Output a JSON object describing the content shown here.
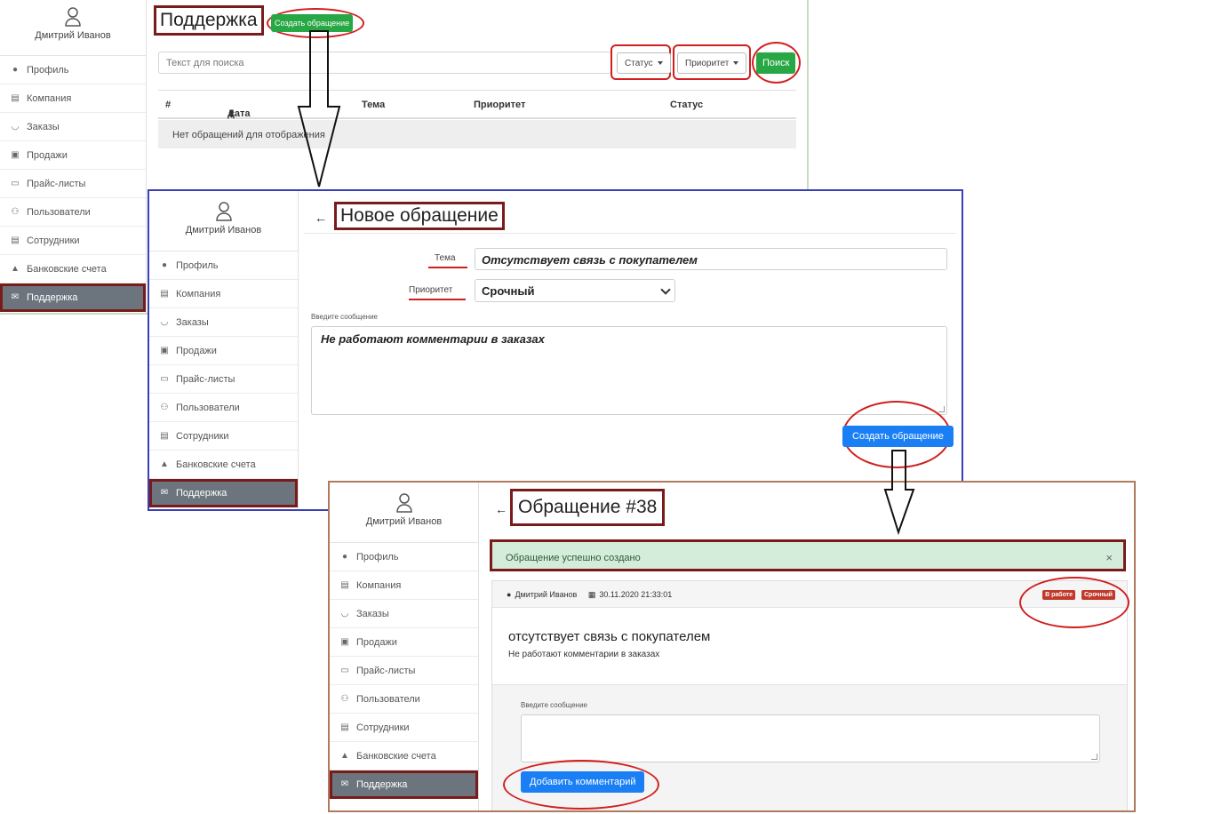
{
  "user_name": "Дмитрий Иванов",
  "nav": [
    {
      "icon": "user-icon",
      "label": "Профиль"
    },
    {
      "icon": "building-icon",
      "label": "Компания"
    },
    {
      "icon": "basket-icon",
      "label": "Заказы"
    },
    {
      "icon": "register-icon",
      "label": "Продажи"
    },
    {
      "icon": "money-icon",
      "label": "Прайс-листы"
    },
    {
      "icon": "users-icon",
      "label": "Пользователи"
    },
    {
      "icon": "id-card-icon",
      "label": "Сотрудники"
    },
    {
      "icon": "bank-icon",
      "label": "Банковские счета"
    },
    {
      "icon": "comments-icon",
      "label": "Поддержка"
    }
  ],
  "support_list": {
    "title": "Поддержка",
    "create_button": "Создать обращение",
    "search_placeholder": "Текст для поиска",
    "status_dropdown": "Статус",
    "priority_dropdown": "Приоритет",
    "search_button": "Поиск",
    "columns": [
      "#",
      "Дата",
      "Тема",
      "Приоритет",
      "Статус"
    ],
    "empty_message": "Нет обращений для отображения"
  },
  "new_ticket": {
    "title": "Новое обращение",
    "subject_label": "Тема",
    "subject_value": "Отсутствует связь с покупателем",
    "priority_label": "Приоритет",
    "priority_value": "Срочный",
    "message_label": "Введите сообщение",
    "message_value": "Не работают комментарии в заказах",
    "submit_button": "Создать обращение"
  },
  "ticket_view": {
    "title": "Обращение #38",
    "alert": "Обращение успешно создано",
    "alert_close": "×",
    "author": "Дмитрий Иванов",
    "datetime": "30.11.2020 21:33:01",
    "status_badge": "В работе",
    "priority_badge": "Срочный",
    "subject": "отсутствует связь с покупателем",
    "message": "Не работают комментарии в заказах",
    "comment_label": "Введите сообщение",
    "comment_button": "Добавить комментарий"
  },
  "colors": {
    "highlight_box": "#7a1b1b",
    "highlight_ellipse": "#d11f1f",
    "primary": "#1a7ff5",
    "success": "#28a745",
    "active_nav": "#6c757d"
  }
}
